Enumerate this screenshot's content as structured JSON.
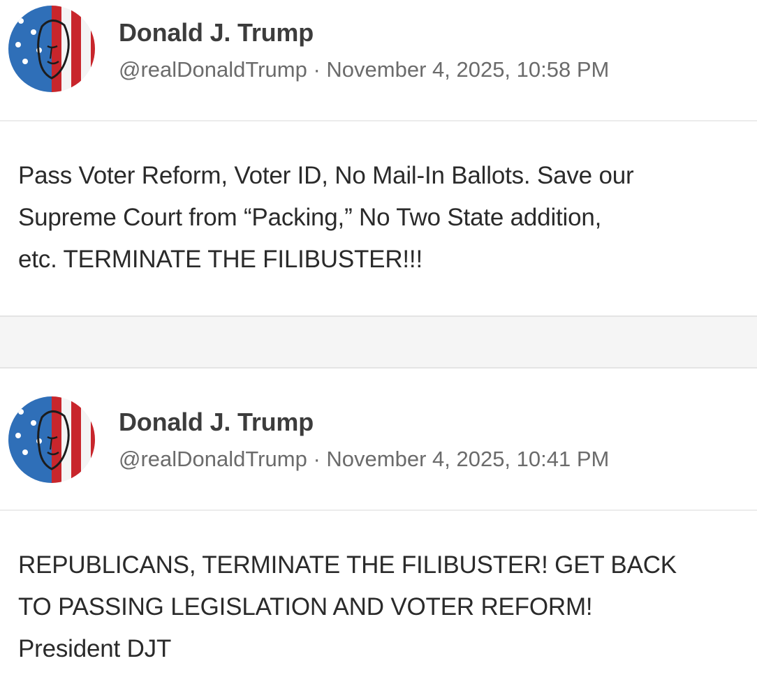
{
  "posts": [
    {
      "author_name": "Donald J. Trump",
      "handle": "@realDonaldTrump",
      "separator": "·",
      "timestamp": "November 4, 2025, 10:58 PM",
      "avatar_icon": "flag-portrait-avatar",
      "body_lines": [
        "Pass Voter Reform, Voter ID, No Mail-In Ballots. Save our",
        "Supreme Court from “Packing,” No Two State addition,",
        "etc. TERMINATE THE FILIBUSTER!!!"
      ]
    },
    {
      "author_name": "Donald J. Trump",
      "handle": "@realDonaldTrump",
      "separator": "·",
      "timestamp": "November 4, 2025, 10:41 PM",
      "avatar_icon": "flag-portrait-avatar",
      "body_lines": [
        "REPUBLICANS, TERMINATE THE FILIBUSTER! GET BACK",
        "TO PASSING LEGISLATION AND VOTER REFORM!",
        "President DJT"
      ]
    }
  ],
  "colors": {
    "name_text": "#3c3c3c",
    "meta_text": "#6b6b6b",
    "body_text": "#2a2a2a",
    "divider": "#ececec",
    "gap_background": "#f5f5f5",
    "flag_red": "#c8262c",
    "flag_blue": "#2f6fb8",
    "flag_white": "#f4f4f4"
  }
}
